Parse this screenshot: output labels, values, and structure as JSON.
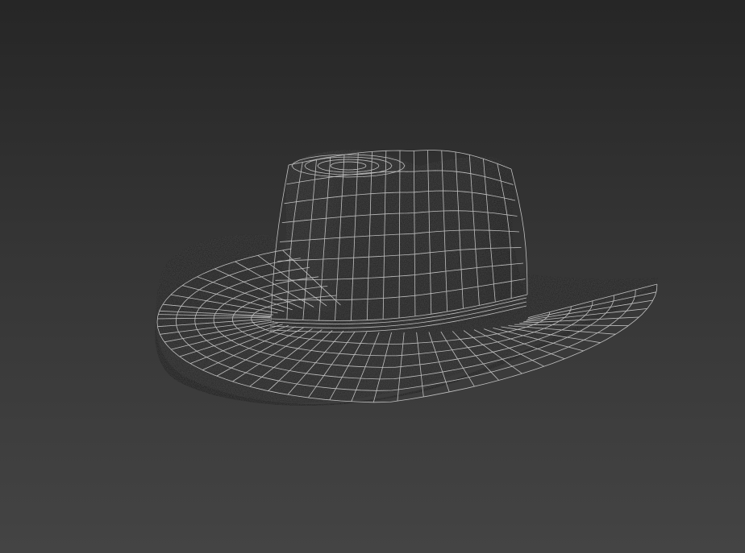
{
  "viewport": {
    "background_top": "#262626",
    "background_bottom": "#444444"
  },
  "model": {
    "object": "cowboy-hat",
    "display_mode": "shaded-wireframe",
    "surface_color": "#141414",
    "wire_color": "#d8d8d8"
  }
}
